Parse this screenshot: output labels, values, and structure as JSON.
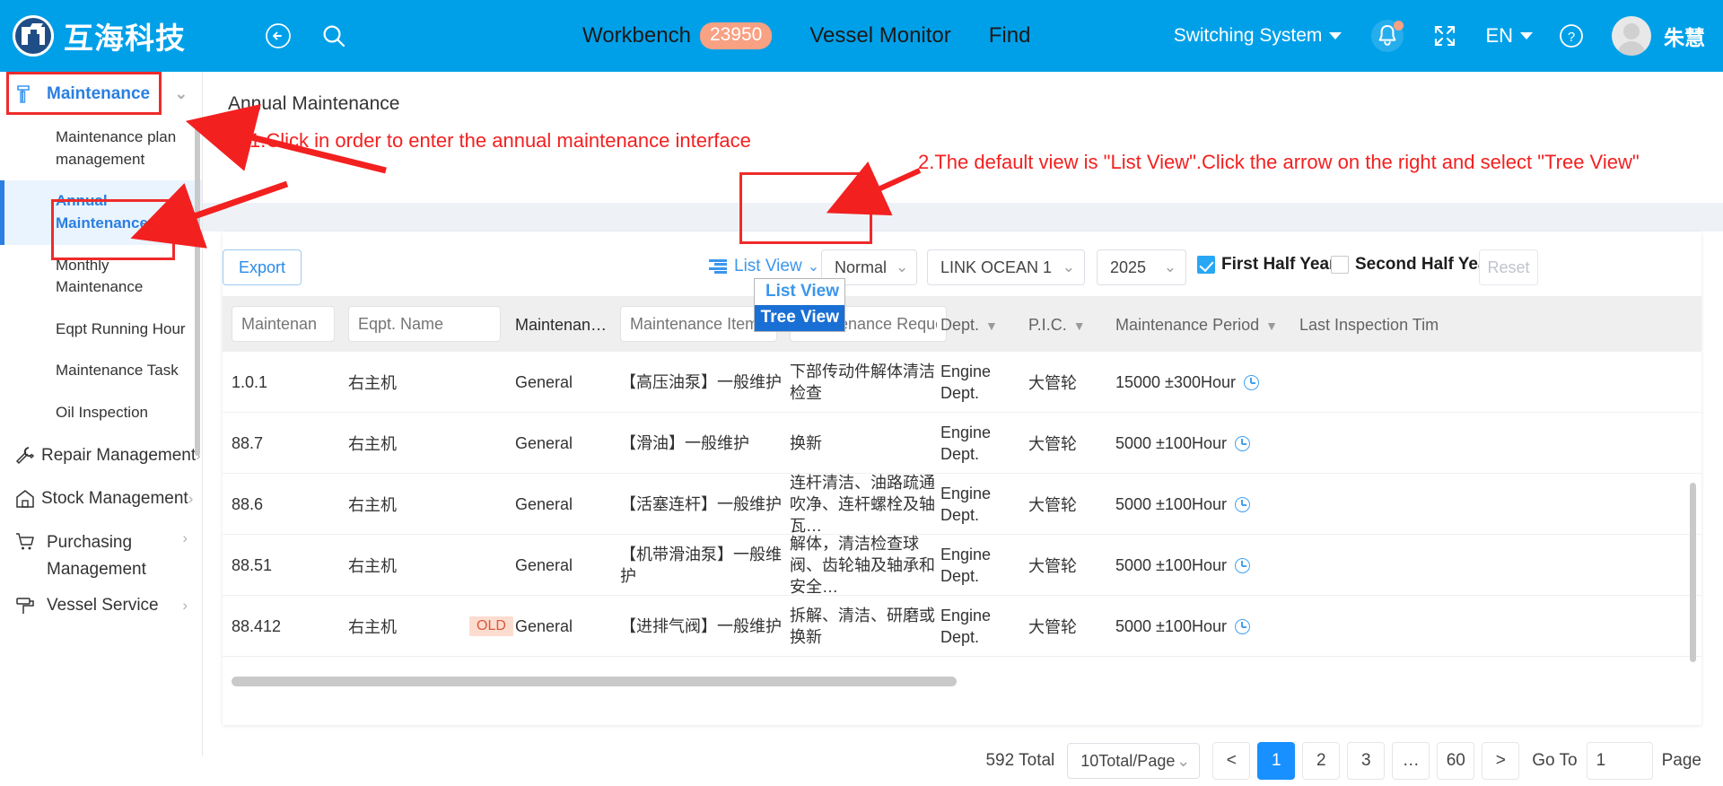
{
  "header": {
    "brand_name": "互海科技",
    "logo_icon": "company-logo-icon",
    "back_icon": "back-arrow-icon",
    "search_icon": "search-icon",
    "nav": [
      {
        "label": "Workbench",
        "badge": "23950"
      },
      {
        "label": "Vessel Monitor",
        "badge": ""
      },
      {
        "label": "Find",
        "badge": ""
      }
    ],
    "switching_system": "Switching System",
    "bell_icon": "notification-bell-icon",
    "expand_icon": "fullscreen-expand-icon",
    "language": "EN",
    "help_icon": "question-mark-circle-icon",
    "user_name": "朱慧",
    "accent": "#00a0e9",
    "badge_color": "#f8a183"
  },
  "sidebar": {
    "groups": [
      {
        "label": "Maintenance",
        "icon": "hammer-icon",
        "chevron": "chevron-down-icon",
        "active": true,
        "children": [
          {
            "label": "Maintenance plan management",
            "active": false
          },
          {
            "label": "Annual Maintenance",
            "active": true
          },
          {
            "label": "Monthly Maintenance",
            "active": false
          },
          {
            "label": "Eqpt Running Hour",
            "active": false
          },
          {
            "label": "Maintenance Task",
            "active": false
          },
          {
            "label": "Oil Inspection",
            "active": false
          }
        ]
      },
      {
        "label": "Repair Management",
        "icon": "wrench-icon",
        "chevron": "chevron-right-icon",
        "children": []
      },
      {
        "label": "Stock Management",
        "icon": "warehouse-icon",
        "chevron": "chevron-right-icon",
        "children": []
      },
      {
        "label": "Purchasing Management",
        "icon": "shopping-cart-icon",
        "chevron": "chevron-right-icon",
        "children": []
      },
      {
        "label": "Vessel Service",
        "icon": "paint-roller-icon",
        "chevron": "chevron-right-icon",
        "children": []
      }
    ]
  },
  "main": {
    "page_title": "Annual Maintenance",
    "toolbar": {
      "export_label": "Export",
      "view_icon": "list-view-icon",
      "view_selected": "List View",
      "view_chevron": "chevron-down-icon",
      "view_options": [
        {
          "label": "List View",
          "selected": false
        },
        {
          "label": "Tree View",
          "selected": true
        }
      ],
      "mode_select": "Normal",
      "vessel_select": "LINK OCEAN 1",
      "year_select": "2025",
      "first_half_label": "First Half Year",
      "first_half_checked": true,
      "second_half_label": "Second Half Year",
      "second_half_checked": false,
      "reset_label": "Reset"
    },
    "table": {
      "filters": {
        "code_placeholder": "Maintenan",
        "eqpt_placeholder": "Eqpt. Name",
        "item_placeholder": "Maintenance Item",
        "req_placeholder": "Maintenance Reque"
      },
      "headers": {
        "type": "Maintenan…",
        "dept": "Dept.",
        "pic": "P.I.C.",
        "period": "Maintenance Period",
        "last": "Last Inspection Tim"
      },
      "rows": [
        {
          "code": "1.0.1",
          "eqpt": "右主机",
          "old": "",
          "type": "General",
          "item": "【高压油泵】一般维护",
          "req": "下部传动件解体清洁检查",
          "dept": "Engine Dept.",
          "pic": "大管轮",
          "period": "15000 ±300Hour",
          "period_icon": "clock-icon"
        },
        {
          "code": "88.7",
          "eqpt": "右主机",
          "old": "",
          "type": "General",
          "item": "【滑油】一般维护",
          "req": "换新",
          "dept": "Engine Dept.",
          "pic": "大管轮",
          "period": "5000 ±100Hour",
          "period_icon": "clock-icon"
        },
        {
          "code": "88.6",
          "eqpt": "右主机",
          "old": "",
          "type": "General",
          "item": "【活塞连杆】一般维护",
          "req": "连杆清洁、油路疏通吹净、连杆螺栓及轴瓦…",
          "dept": "Engine Dept.",
          "pic": "大管轮",
          "period": "5000 ±100Hour",
          "period_icon": "clock-icon"
        },
        {
          "code": "88.51",
          "eqpt": "右主机",
          "old": "",
          "type": "General",
          "item": "【机带滑油泵】一般维护",
          "req": "解体，清洁检查球阀、齿轮轴及轴承和安全…",
          "dept": "Engine Dept.",
          "pic": "大管轮",
          "period": "5000 ±100Hour",
          "period_icon": "clock-icon"
        },
        {
          "code": "88.412",
          "eqpt": "右主机",
          "old": "OLD",
          "type": "General",
          "item": "【进排气阀】一般维护",
          "req": "拆解、清洁、研磨或换新",
          "dept": "Engine Dept.",
          "pic": "大管轮",
          "period": "5000 ±100Hour",
          "period_icon": "clock-icon"
        }
      ]
    },
    "pagination": {
      "total_text": "592 Total",
      "page_size": "10Total/Page",
      "prev": "<",
      "pages": [
        "1",
        "2",
        "3",
        "…",
        "60"
      ],
      "current_page": "1",
      "next": ">",
      "goto_label": "Go To",
      "goto_value": "1",
      "page_word": "Page"
    }
  },
  "annotations": {
    "step1": "1.Click in order to enter the annual maintenance interface",
    "step2": "2.The default view is \"List View\".Click the arrow on the right and select \"Tree View\"",
    "color": "#f32020"
  }
}
